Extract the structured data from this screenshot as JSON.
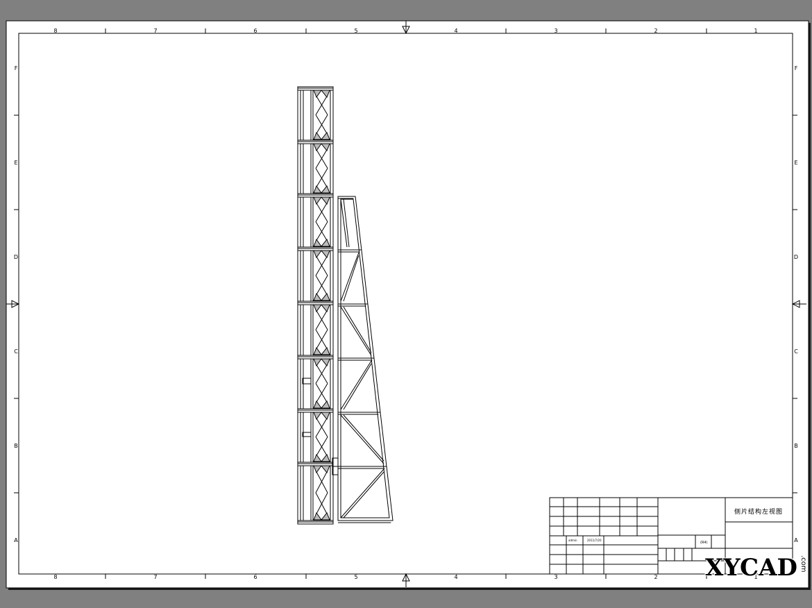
{
  "border": {
    "columns_top": [
      "8",
      "7",
      "6",
      "5",
      "4",
      "3",
      "2",
      "1"
    ],
    "columns_bottom": [
      "8",
      "7",
      "6",
      "5",
      "4",
      "3",
      "2",
      "1"
    ],
    "rows_left": [
      "F",
      "E",
      "D",
      "C",
      "B",
      "A"
    ],
    "rows_right": [
      "F",
      "E",
      "D",
      "C",
      "B",
      "A"
    ]
  },
  "title_block": {
    "drawing_title": "侧片结构左视图",
    "designer": "admin",
    "date": "2011/7/20",
    "scale_label": "(R4)"
  },
  "watermark": {
    "brand": "XYCAD",
    "suffix": ".com"
  },
  "colors": {
    "background": "#808080",
    "sheet": "#ffffff",
    "ink": "#000000"
  }
}
